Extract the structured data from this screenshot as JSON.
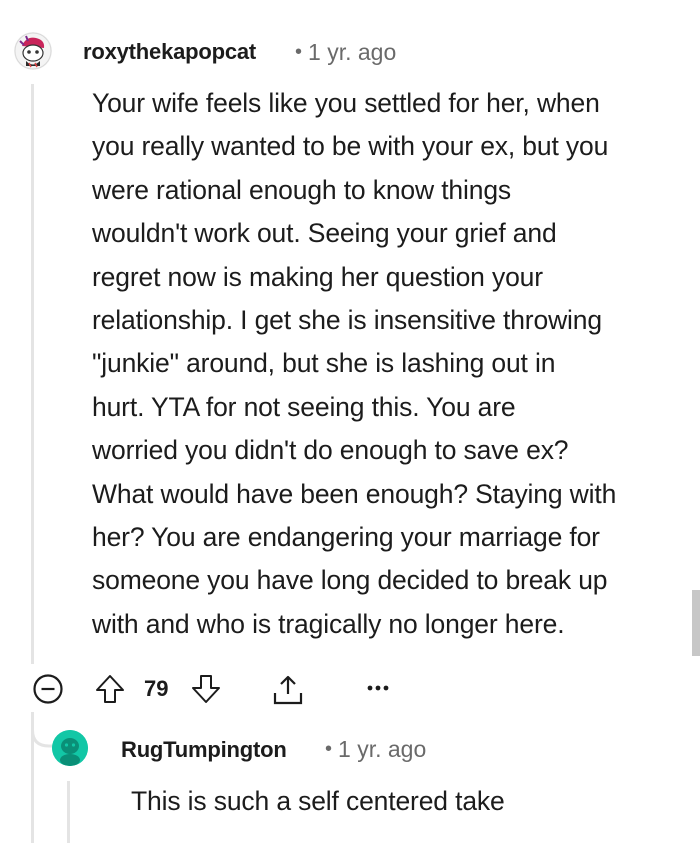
{
  "comment": {
    "username": "roxythekapopcat",
    "separator": "•",
    "time": "1 yr. ago",
    "body": "Your wife feels like you settled for her, when\nyou really wanted to be with your ex, but you\nwere rational enough to know things\nwouldn't work out. Seeing your grief and\nregret now is making her question your\nrelationship. I get she is insensitive throwing\n\"junkie\" around, but she is lashing out in\nhurt. YTA for not seeing this. You are\nworried you didn't do enough to save ex?\nWhat would have been enough? Staying with\nher? You are endangering your marriage for\nsomeone you have long decided to break up\nwith and who is tragically no longer here.",
    "score": "79",
    "more_label": "•••"
  },
  "reply": {
    "username": "RugTumpington",
    "separator": "•",
    "time": "1 yr. ago",
    "body": "This is such a self centered take"
  },
  "colors": {
    "text": "#1c1c1c",
    "meta": "#6a6a6a",
    "thread_line": "#e4e4e4",
    "reply_avatar": "#12c7a6"
  },
  "icons": [
    "avatar",
    "collapse-icon",
    "upvote-icon",
    "downvote-icon",
    "share-icon",
    "more-icon"
  ]
}
